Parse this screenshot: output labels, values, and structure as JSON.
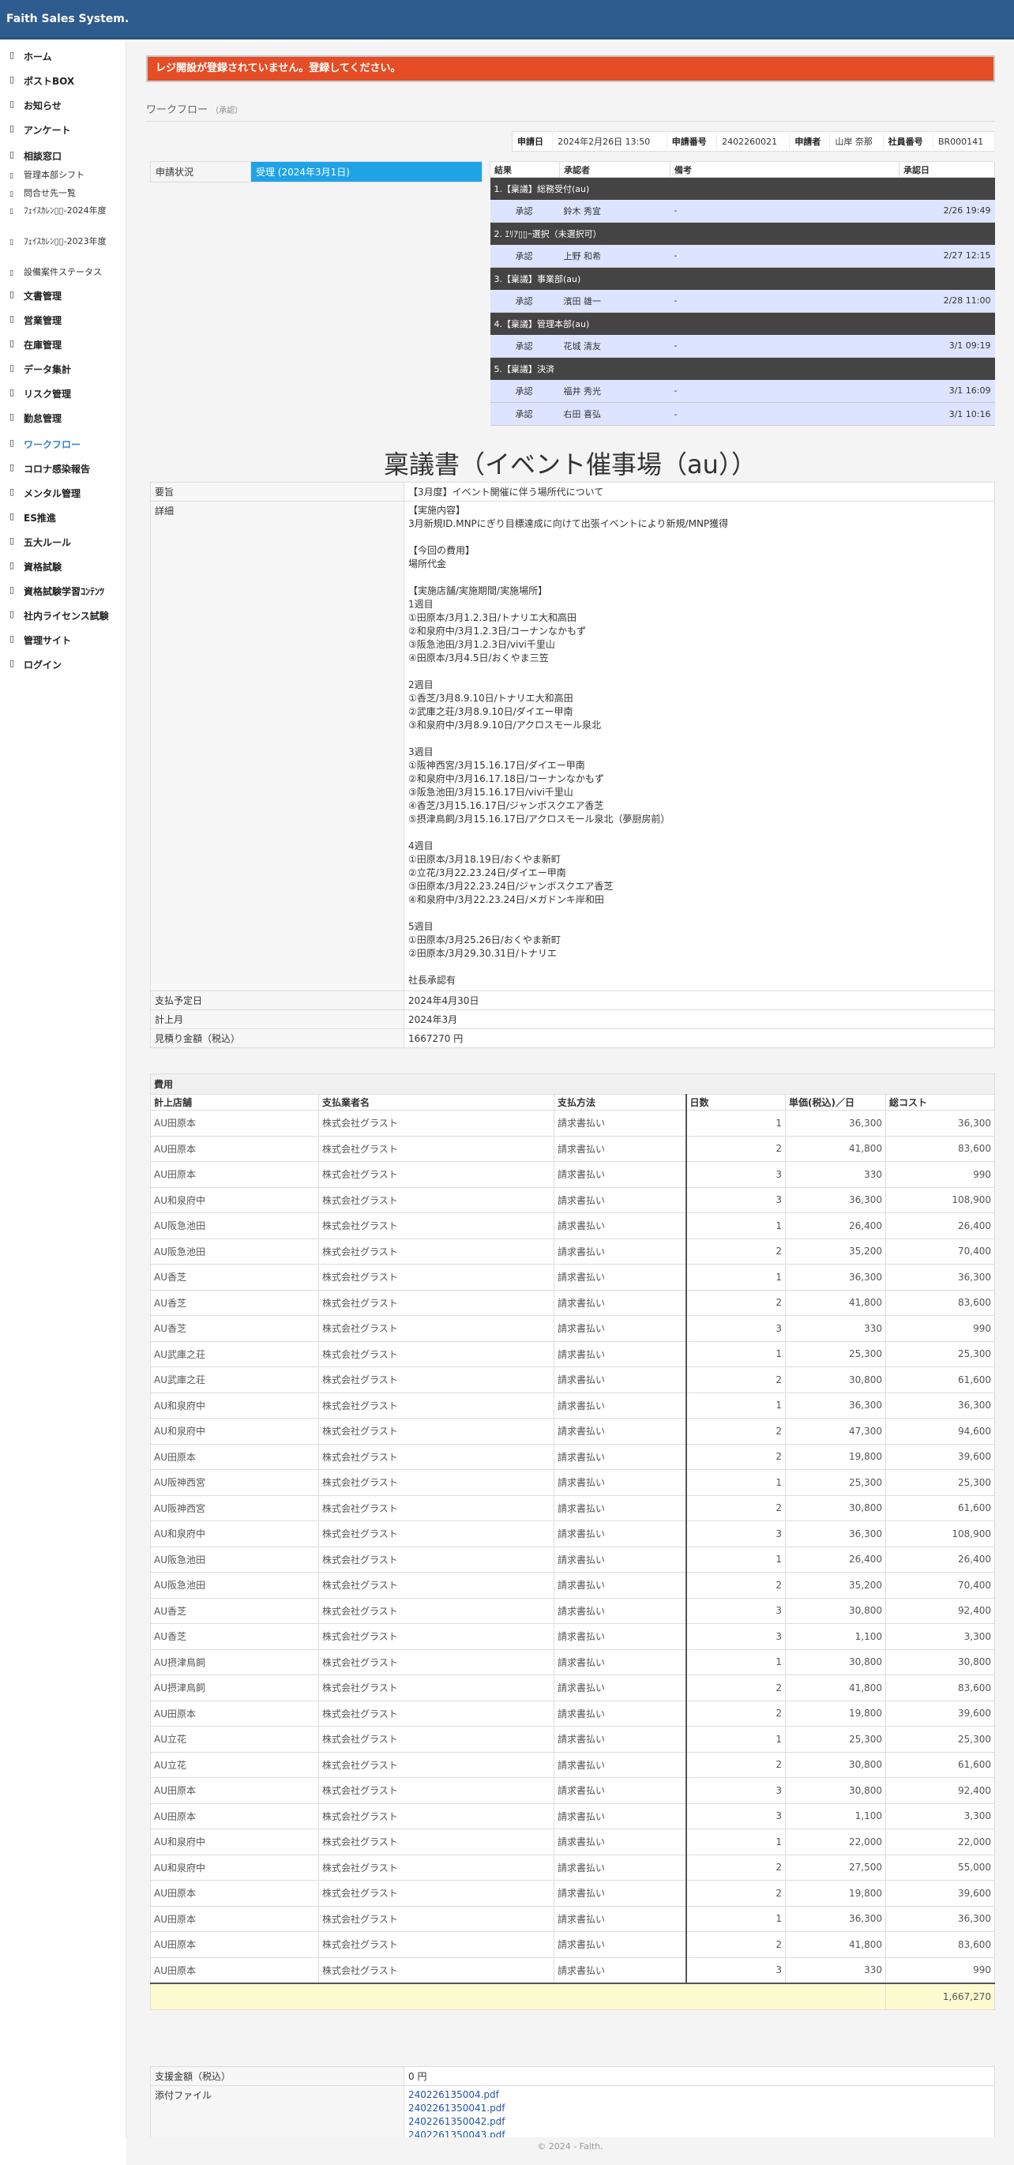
{
  "app": {
    "brand": "Faith Sales System."
  },
  "sidebar": {
    "items": [
      {
        "label": "ホーム",
        "icon": "home-icon"
      },
      {
        "label": "ポストBOX",
        "icon": "mailbox-icon"
      },
      {
        "label": "お知らせ",
        "icon": "bell-icon"
      },
      {
        "label": "アンケート",
        "icon": "survey-icon"
      },
      {
        "label": "相談窓口",
        "icon": "consult-icon"
      },
      {
        "label": "文書管理",
        "icon": "document-icon"
      },
      {
        "label": "営業管理",
        "icon": "sales-icon"
      },
      {
        "label": "在庫管理",
        "icon": "inventory-icon"
      },
      {
        "label": "データ集計",
        "icon": "chart-icon"
      },
      {
        "label": "リスク管理",
        "icon": "risk-icon"
      },
      {
        "label": "勤怠管理",
        "icon": "clock-icon"
      },
      {
        "label": "ワークフロー",
        "icon": "workflow-icon"
      },
      {
        "label": "コロナ感染報告",
        "icon": "report-icon"
      },
      {
        "label": "メンタル管理",
        "icon": "heart-icon"
      },
      {
        "label": "ES推進",
        "icon": "es-icon"
      },
      {
        "label": "五大ルール",
        "icon": "rule-icon"
      },
      {
        "label": "資格試験",
        "icon": "license-icon"
      },
      {
        "label": "資格試験学習ｺﾝﾃﾝﾂ",
        "icon": "study-icon"
      },
      {
        "label": "社内ライセンス試験",
        "icon": "badge-icon"
      },
      {
        "label": "管理サイト",
        "icon": "admin-icon"
      },
      {
        "label": "ログイン",
        "icon": "login-icon"
      }
    ],
    "subitems": [
      {
        "label": "管理本部シフト"
      },
      {
        "label": "問合せ先一覧"
      },
      {
        "label": "ﾌｪｲｽｶﾚﾝ▯▯-2024年度"
      },
      {
        "label": "ﾌｪｲｽｶﾚﾝ▯▯-2023年度"
      },
      {
        "label": "設備案件ステータス"
      }
    ]
  },
  "alert": {
    "text": "レジ開設が登録されていません。登録してください。"
  },
  "breadcrumb": {
    "title": "ワークフロー",
    "sub": "（承認）"
  },
  "info": {
    "apply_date_label": "申請日",
    "apply_date": "2024年2月26日 13:50",
    "apply_no_label": "申請番号",
    "apply_no": "2402260021",
    "applicant_label": "申請者",
    "applicant": "山岸 奈那",
    "emp_no_label": "社員番号",
    "emp_no": "BR000141"
  },
  "status": {
    "label": "申請状況",
    "value": "受理 (2024年3月1日)"
  },
  "flow": {
    "headers": [
      "結果",
      "承認者",
      "備考",
      "承認日"
    ],
    "steps": [
      {
        "title": "1.【稟議】総務受付(au)",
        "rows": [
          {
            "result": "承認",
            "approver": "鈴木 秀宜",
            "note": "-",
            "date": "2/26 19:49"
          }
        ]
      },
      {
        "title": "2. ｴﾘｱ▯▯ｰ選択（未選択可）",
        "rows": [
          {
            "result": "承認",
            "approver": "上野 和希",
            "note": "-",
            "date": "2/27 12:15"
          }
        ]
      },
      {
        "title": "3.【稟議】事業部(au)",
        "rows": [
          {
            "result": "承認",
            "approver": "濱田 雄一",
            "note": "-",
            "date": "2/28 11:00"
          }
        ]
      },
      {
        "title": "4.【稟議】管理本部(au)",
        "rows": [
          {
            "result": "承認",
            "approver": "花城 清友",
            "note": "-",
            "date": "3/1 09:19"
          }
        ]
      },
      {
        "title": "5.【稟議】決済",
        "rows": [
          {
            "result": "承認",
            "approver": "福井 秀光",
            "note": "-",
            "date": "3/1 16:09"
          },
          {
            "result": "承認",
            "approver": "右田 喜弘",
            "note": "-",
            "date": "3/1 10:16"
          }
        ]
      }
    ]
  },
  "doc": {
    "title": "稟議書（イベント催事場（au））",
    "summary_label": "要旨",
    "summary": "【3月度】イベント開催に伴う場所代について",
    "detail_label": "詳細",
    "detail": "【実施内容】\n3月新規ID.MNPにぎり目標達成に向けて出張イベントにより新規/MNP獲得\n\n【今回の費用】\n場所代金\n\n【実施店舗/実施期間/実施場所】\n1週目\n①田原本/3月1.2.3日/トナリエ大和高田\n②和泉府中/3月1.2.3日/コーナンなかもず\n③阪急池田/3月1.2.3日/vivi千里山\n④田原本/3月4.5日/おくやま三笠\n\n2週目\n①香芝/3月8.9.10日/トナリエ大和高田\n②武庫之荘/3月8.9.10日/ダイエー甲南\n③和泉府中/3月8.9.10日/アクロスモール泉北\n\n3週目\n①阪神西宮/3月15.16.17日/ダイエー甲南\n②和泉府中/3月16.17.18日/コーナンなかもず\n③阪急池田/3月15.16.17日/vivi千里山\n④香芝/3月15.16.17日/ジャンボスクエア香芝\n⑤摂津鳥飼/3月15.16.17日/アクロスモール泉北（夢厨房前）\n\n4週目\n①田原本/3月18.19日/おくやま新町\n②立花/3月22.23.24日/ダイエー甲南\n③田原本/3月22.23.24日/ジャンボスクエア香芝\n④和泉府中/3月22.23.24日/メガドンキ岸和田\n\n5週目\n①田原本/3月25.26日/おくやま新町\n②田原本/3月29.30.31日/トナリエ\n\n社長承認有",
    "pay_date_label": "支払予定日",
    "pay_date": "2024年4月30日",
    "month_label": "計上月",
    "month": "2024年3月",
    "estimate_label": "見積り金額（税込）",
    "estimate": "1667270 円"
  },
  "costs": {
    "section_label": "費用",
    "headers": [
      "計上店舗",
      "支払業者名",
      "支払方法",
      "日数",
      "単価(税込)／日",
      "総コスト"
    ],
    "rows": [
      [
        "AU田原本",
        "株式会社グラスト",
        "請求書払い",
        "1",
        "36,300",
        "36,300"
      ],
      [
        "AU田原本",
        "株式会社グラスト",
        "請求書払い",
        "2",
        "41,800",
        "83,600"
      ],
      [
        "AU田原本",
        "株式会社グラスト",
        "請求書払い",
        "3",
        "330",
        "990"
      ],
      [
        "AU和泉府中",
        "株式会社グラスト",
        "請求書払い",
        "3",
        "36,300",
        "108,900"
      ],
      [
        "AU阪急池田",
        "株式会社グラスト",
        "請求書払い",
        "1",
        "26,400",
        "26,400"
      ],
      [
        "AU阪急池田",
        "株式会社グラスト",
        "請求書払い",
        "2",
        "35,200",
        "70,400"
      ],
      [
        "AU香芝",
        "株式会社グラスト",
        "請求書払い",
        "1",
        "36,300",
        "36,300"
      ],
      [
        "AU香芝",
        "株式会社グラスト",
        "請求書払い",
        "2",
        "41,800",
        "83,600"
      ],
      [
        "AU香芝",
        "株式会社グラスト",
        "請求書払い",
        "3",
        "330",
        "990"
      ],
      [
        "AU武庫之荘",
        "株式会社グラスト",
        "請求書払い",
        "1",
        "25,300",
        "25,300"
      ],
      [
        "AU武庫之荘",
        "株式会社グラスト",
        "請求書払い",
        "2",
        "30,800",
        "61,600"
      ],
      [
        "AU和泉府中",
        "株式会社グラスト",
        "請求書払い",
        "1",
        "36,300",
        "36,300"
      ],
      [
        "AU和泉府中",
        "株式会社グラスト",
        "請求書払い",
        "2",
        "47,300",
        "94,600"
      ],
      [
        "AU田原本",
        "株式会社グラスト",
        "請求書払い",
        "2",
        "19,800",
        "39,600"
      ],
      [
        "AU阪神西宮",
        "株式会社グラスト",
        "請求書払い",
        "1",
        "25,300",
        "25,300"
      ],
      [
        "AU阪神西宮",
        "株式会社グラスト",
        "請求書払い",
        "2",
        "30,800",
        "61,600"
      ],
      [
        "AU和泉府中",
        "株式会社グラスト",
        "請求書払い",
        "3",
        "36,300",
        "108,900"
      ],
      [
        "AU阪急池田",
        "株式会社グラスト",
        "請求書払い",
        "1",
        "26,400",
        "26,400"
      ],
      [
        "AU阪急池田",
        "株式会社グラスト",
        "請求書払い",
        "2",
        "35,200",
        "70,400"
      ],
      [
        "AU香芝",
        "株式会社グラスト",
        "請求書払い",
        "3",
        "30,800",
        "92,400"
      ],
      [
        "AU香芝",
        "株式会社グラスト",
        "請求書払い",
        "3",
        "1,100",
        "3,300"
      ],
      [
        "AU摂津鳥飼",
        "株式会社グラスト",
        "請求書払い",
        "1",
        "30,800",
        "30,800"
      ],
      [
        "AU摂津鳥飼",
        "株式会社グラスト",
        "請求書払い",
        "2",
        "41,800",
        "83,600"
      ],
      [
        "AU田原本",
        "株式会社グラスト",
        "請求書払い",
        "2",
        "19,800",
        "39,600"
      ],
      [
        "AU立花",
        "株式会社グラスト",
        "請求書払い",
        "1",
        "25,300",
        "25,300"
      ],
      [
        "AU立花",
        "株式会社グラスト",
        "請求書払い",
        "2",
        "30,800",
        "61,600"
      ],
      [
        "AU田原本",
        "株式会社グラスト",
        "請求書払い",
        "3",
        "30,800",
        "92,400"
      ],
      [
        "AU田原本",
        "株式会社グラスト",
        "請求書払い",
        "3",
        "1,100",
        "3,300"
      ],
      [
        "AU和泉府中",
        "株式会社グラスト",
        "請求書払い",
        "1",
        "22,000",
        "22,000"
      ],
      [
        "AU和泉府中",
        "株式会社グラスト",
        "請求書払い",
        "2",
        "27,500",
        "55,000"
      ],
      [
        "AU田原本",
        "株式会社グラスト",
        "請求書払い",
        "2",
        "19,800",
        "39,600"
      ],
      [
        "AU田原本",
        "株式会社グラスト",
        "請求書払い",
        "1",
        "36,300",
        "36,300"
      ],
      [
        "AU田原本",
        "株式会社グラスト",
        "請求書払い",
        "2",
        "41,800",
        "83,600"
      ],
      [
        "AU田原本",
        "株式会社グラスト",
        "請求書払い",
        "3",
        "330",
        "990"
      ]
    ],
    "total": "1,667,270"
  },
  "payment": {
    "amount_label": "支援金額（税込）",
    "amount": "0 円",
    "files_label": "添付ファイル",
    "files": [
      "240226135004.pdf",
      "2402261350041.pdf",
      "2402261350042.pdf",
      "2402261350043.pdf"
    ]
  },
  "footer": {
    "text": "© 2024 - Faith."
  }
}
